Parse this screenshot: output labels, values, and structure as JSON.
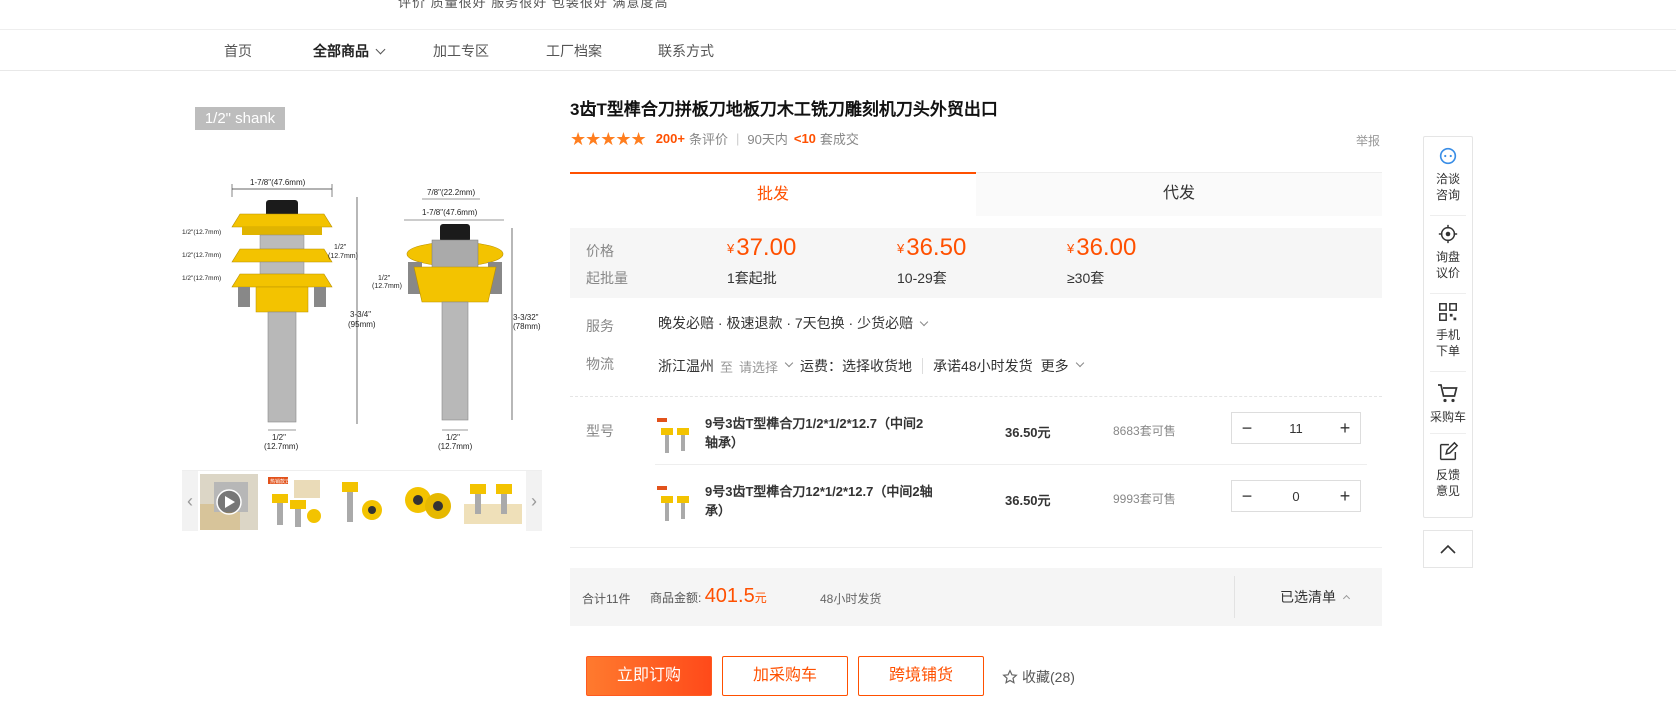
{
  "top_strip": {
    "cut_text": "评价  质量很好  服务很好  包装很好  满意度高"
  },
  "nav": {
    "items": [
      "首页",
      "全部商品",
      "加工专区",
      "工厂档案",
      "联系方式"
    ]
  },
  "gallery": {
    "tag": "1/2\" shank",
    "dims": {
      "top_width": "1-7/8\"(47.6mm)",
      "cutter_a": "1/2\"(12.7mm)",
      "cutter_b": "1/2\"(12.7mm)",
      "cutter_c": "1/2\"(12.7mm)",
      "right_small": "1/2\"",
      "right_small_mm": "(12.7mm)",
      "height_in": "3-3/4\"",
      "height_mm": "(95mm)",
      "shank_in": "1/2\"",
      "shank_mm": "(12.7mm)",
      "r_top": "7/8\"(22.2mm)",
      "r_width": "1-7/8\"(47.6mm)",
      "r_cut": "1/2\"",
      "r_cut_mm": "(12.7mm)",
      "r_height_in": "3-3/32\"",
      "r_height_mm": "(78mm)",
      "r_shank_in": "1/2\"",
      "r_shank_mm": "(12.7mm)"
    },
    "thumb_tag": "热销款式"
  },
  "product": {
    "title": "3齿T型榫合刀拼板刀地板刀木工铣刀雕刻机刀头外贸出口",
    "stars": "★★★★★",
    "review_count": "200+",
    "review_label": "条评价",
    "sold_prefix": "90天内",
    "sold_count": "<10",
    "sold_suffix": "套成交",
    "report": "举报"
  },
  "tabs": [
    "批发",
    "代发"
  ],
  "pricing": {
    "price_label": "价格",
    "moq_label": "起批量",
    "currency": "¥",
    "tiers": [
      {
        "price": "37.00",
        "qty": "1套起批"
      },
      {
        "price": "36.50",
        "qty": "10-29套"
      },
      {
        "price": "36.00",
        "qty": "≥30套"
      }
    ]
  },
  "service": {
    "label": "服务",
    "text": "晚发必赔 · 极速退款 · 7天包换 · 少货必赔"
  },
  "logistics": {
    "label": "物流",
    "origin": "浙江温州",
    "to": "至",
    "select": "请选择",
    "freight": "运费：选择收货地",
    "promise": "承诺48小时发货",
    "more": "更多"
  },
  "sku": {
    "label": "型号",
    "rows": [
      {
        "name": "9号3齿T型榫合刀1/2*1/2*12.7（中间2轴承）",
        "price": "36.50元",
        "stock": "8683套可售",
        "qty": "11"
      },
      {
        "name": "9号3齿T型榫合刀12*1/2*12.7（中间2轴承）",
        "price": "36.50元",
        "stock": "9993套可售",
        "qty": "0"
      }
    ],
    "minus": "−",
    "plus": "+"
  },
  "summary": {
    "total": "合计11件",
    "amount_label": "商品金额:",
    "amount": "401.5",
    "amount_unit": "元",
    "ship": "48小时发货",
    "list": "已选清单"
  },
  "actions": {
    "buy": "立即订购",
    "cart": "加采购车",
    "cross": "跨境铺货",
    "fav": "收藏(28)"
  },
  "rail": {
    "items": [
      {
        "l1": "洽谈",
        "l2": "咨询"
      },
      {
        "l1": "询盘",
        "l2": "议价"
      },
      {
        "l1": "手机",
        "l2": "下单"
      },
      {
        "l1": "采购车",
        "l2": ""
      },
      {
        "l1": "反馈",
        "l2": "意见"
      }
    ]
  },
  "colors": {
    "accent": "#ff5000",
    "yellow": "#f4c000",
    "star": "#ff7e1f"
  }
}
